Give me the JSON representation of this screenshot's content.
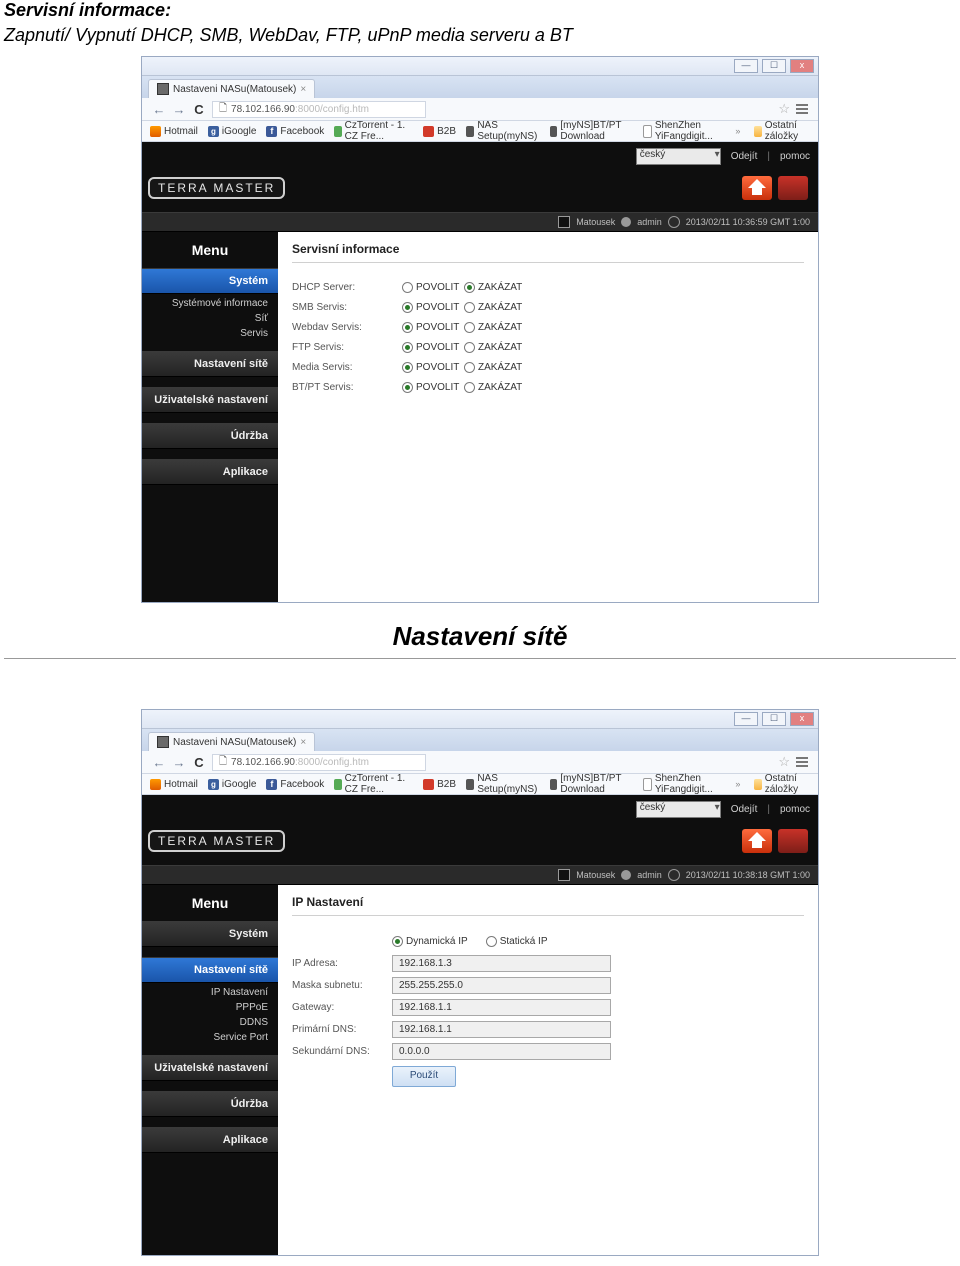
{
  "doc": {
    "heading": "Servisní informace:",
    "subheading": "Zapnutí/ Vypnutí DHCP, SMB, WebDav, FTP, uPnP media serveru a BT",
    "section2_title": "Nastavení sítě"
  },
  "window": {
    "minimize": "—",
    "maximize": "☐",
    "close": "x"
  },
  "tab": {
    "title": "Nastaveni NASu(Matousek)"
  },
  "address": {
    "host": "78.102.166.90",
    "path": ":8000/config.htm"
  },
  "bookmarks": {
    "hotmail": "Hotmail",
    "igoogle": "iGoogle",
    "facebook": "Facebook",
    "cztorrent": "CzTorrent - 1. CZ Fre...",
    "b2b": "B2B",
    "nas_setup": "NAS Setup(myNS)",
    "btpt": "[myNS]BT/PT Download",
    "shenzhen": "ShenZhen YiFangdigit...",
    "more": "»",
    "other": "Ostatní záložky"
  },
  "topbar": {
    "language": "český",
    "logout": "Odejít",
    "help": "pomoc"
  },
  "brand": "TERRA MASTER",
  "infobar": {
    "host": "Matousek",
    "user": "admin",
    "time1": "2013/02/11 10:36:59 GMT 1:00",
    "time2": "2013/02/11 10:38:18 GMT 1:00"
  },
  "menu": {
    "title": "Menu",
    "system": "Systém",
    "sys_sub": {
      "info": "Systémové informace",
      "network": "Síť",
      "service": "Servis"
    },
    "network_settings": "Nastavení sítě",
    "net_sub": {
      "ip": "IP Nastavení",
      "pppoe": "PPPoE",
      "ddns": "DDNS",
      "port": "Service Port"
    },
    "user_settings": "Uživatelské nastavení",
    "maintenance": "Údržba",
    "apps": "Aplikace"
  },
  "services_panel": {
    "title": "Servisní informace",
    "allow": "POVOLIT",
    "deny": "ZAKÁZAT",
    "rows": [
      {
        "label": "DHCP Server:",
        "selected": "deny"
      },
      {
        "label": "SMB Servis:",
        "selected": "allow"
      },
      {
        "label": "Webdav Servis:",
        "selected": "allow"
      },
      {
        "label": "FTP Servis:",
        "selected": "allow"
      },
      {
        "label": "Media Servis:",
        "selected": "allow"
      },
      {
        "label": "BT/PT Servis:",
        "selected": "allow"
      }
    ]
  },
  "ip_panel": {
    "title": "IP Nastavení",
    "dynamic": "Dynamická IP",
    "static": "Statická IP",
    "labels": {
      "ip": "IP Adresa:",
      "mask": "Maska subnetu:",
      "gateway": "Gateway:",
      "dns1": "Primární DNS:",
      "dns2": "Sekundární DNS:"
    },
    "values": {
      "ip": "192.168.1.3",
      "mask": "255.255.255.0",
      "gateway": "192.168.1.1",
      "dns1": "192.168.1.1",
      "dns2": "0.0.0.0"
    },
    "apply": "Použít"
  }
}
